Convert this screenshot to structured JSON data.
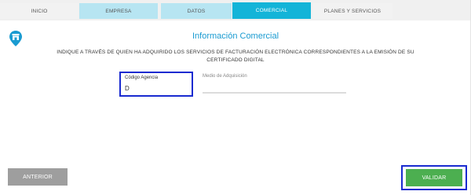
{
  "tabs": [
    {
      "label": "INICIO"
    },
    {
      "label": "EMPRESA"
    },
    {
      "label": "DATOS"
    },
    {
      "label": "COMERCIAL"
    },
    {
      "label": "PLANES Y SERVICIOS"
    }
  ],
  "active_tab": "COMERCIAL",
  "side_icon": "store-pin-icon",
  "section": {
    "title": "Información Comercial",
    "instructions": "INDIQUE A TRAVÉS DE QUIEN HA ADQUIRIDO LOS SERVICIOS DE FACTURACIÓN ELECTRÓNICA CORRESPONDIENTES A LA EMISIÓN DE SU CERTIFICADO DIGITAL"
  },
  "form": {
    "codigo_agencia": {
      "label": "Código Agencia",
      "value": "D"
    },
    "medio_adquisicion": {
      "label": "Medio de Adquisición",
      "value": ""
    }
  },
  "buttons": {
    "anterior": "ANTERIOR",
    "validar": "VALIDAR"
  },
  "colors": {
    "accent": "#13b4d8",
    "tab_light": "#b7e5f2",
    "title": "#1a9bd1",
    "success": "#4caf50",
    "neutral_button": "#9e9e9e",
    "highlight": "#1a2bd0"
  }
}
